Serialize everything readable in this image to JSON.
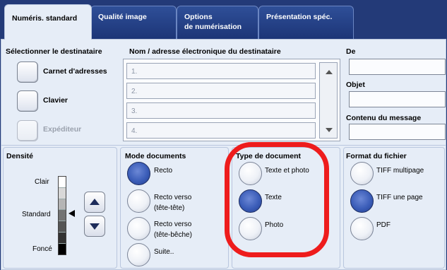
{
  "tabs": [
    {
      "label": "Numéris. standard"
    },
    {
      "label": "Qualité image"
    },
    {
      "label": "Options",
      "label2": "de numérisation"
    },
    {
      "label": "Présentation spéc."
    }
  ],
  "destination": {
    "section_title": "Sélectionner le destinataire",
    "address_book": "Carnet d'adresses",
    "keyboard": "Clavier",
    "sender": "Expéditeur"
  },
  "recipients": {
    "title": "Nom / adresse électronique du destinataire",
    "rows": [
      "1.",
      "2.",
      "3.",
      "4."
    ]
  },
  "message": {
    "from_label": "De",
    "subject_label": "Objet",
    "body_label": "Contenu du message",
    "from_value": "",
    "subject_value": "",
    "body_value": ""
  },
  "density": {
    "title": "Densité",
    "light": "Clair",
    "standard": "Standard",
    "dark": "Foncé"
  },
  "document_mode": {
    "title": "Mode documents",
    "options": [
      {
        "label": "Recto",
        "label2": "",
        "selected": true
      },
      {
        "label": "Recto verso",
        "label2": "(tête-tête)",
        "selected": false
      },
      {
        "label": "Recto verso",
        "label2": "(tête-bêche)",
        "selected": false
      },
      {
        "label": "Suite..",
        "label2": "",
        "selected": false
      }
    ]
  },
  "document_type": {
    "title": "Type de document",
    "options": [
      {
        "label": "Texte et photo",
        "selected": false
      },
      {
        "label": "Texte",
        "selected": true
      },
      {
        "label": "Photo",
        "selected": false
      }
    ]
  },
  "file_format": {
    "title": "Format du fichier",
    "options": [
      {
        "label": "TIFF multipage",
        "selected": false
      },
      {
        "label": "TIFF une page",
        "selected": true
      },
      {
        "label": "PDF",
        "selected": false
      }
    ]
  },
  "colors": {
    "highlight": "#ee1c1c",
    "tab_bg": "#233a78",
    "panel_bg": "#e6edf7",
    "radio_selected": "#3b5db8"
  }
}
